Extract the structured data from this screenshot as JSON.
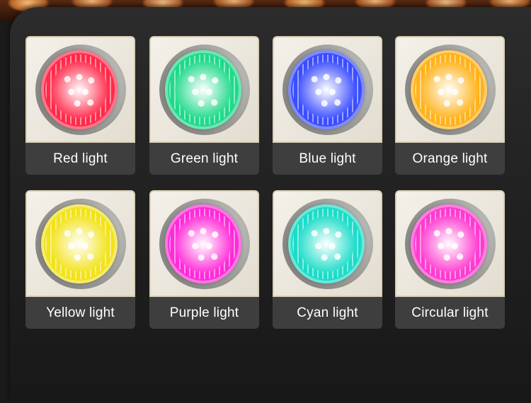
{
  "cards": [
    {
      "label": "Red light",
      "color": "#ff2a4a"
    },
    {
      "label": "Green light",
      "color": "#1fd98a"
    },
    {
      "label": "Blue light",
      "color": "#3a4dff"
    },
    {
      "label": "Orange light",
      "color": "#ffb21a"
    },
    {
      "label": "Yellow light",
      "color": "#f2e21a"
    },
    {
      "label": "Purple light",
      "color": "#ff2ad8"
    },
    {
      "label": "Cyan light",
      "color": "#1adcc8"
    },
    {
      "label": "Circular light",
      "color": "#ff3ad0"
    }
  ]
}
